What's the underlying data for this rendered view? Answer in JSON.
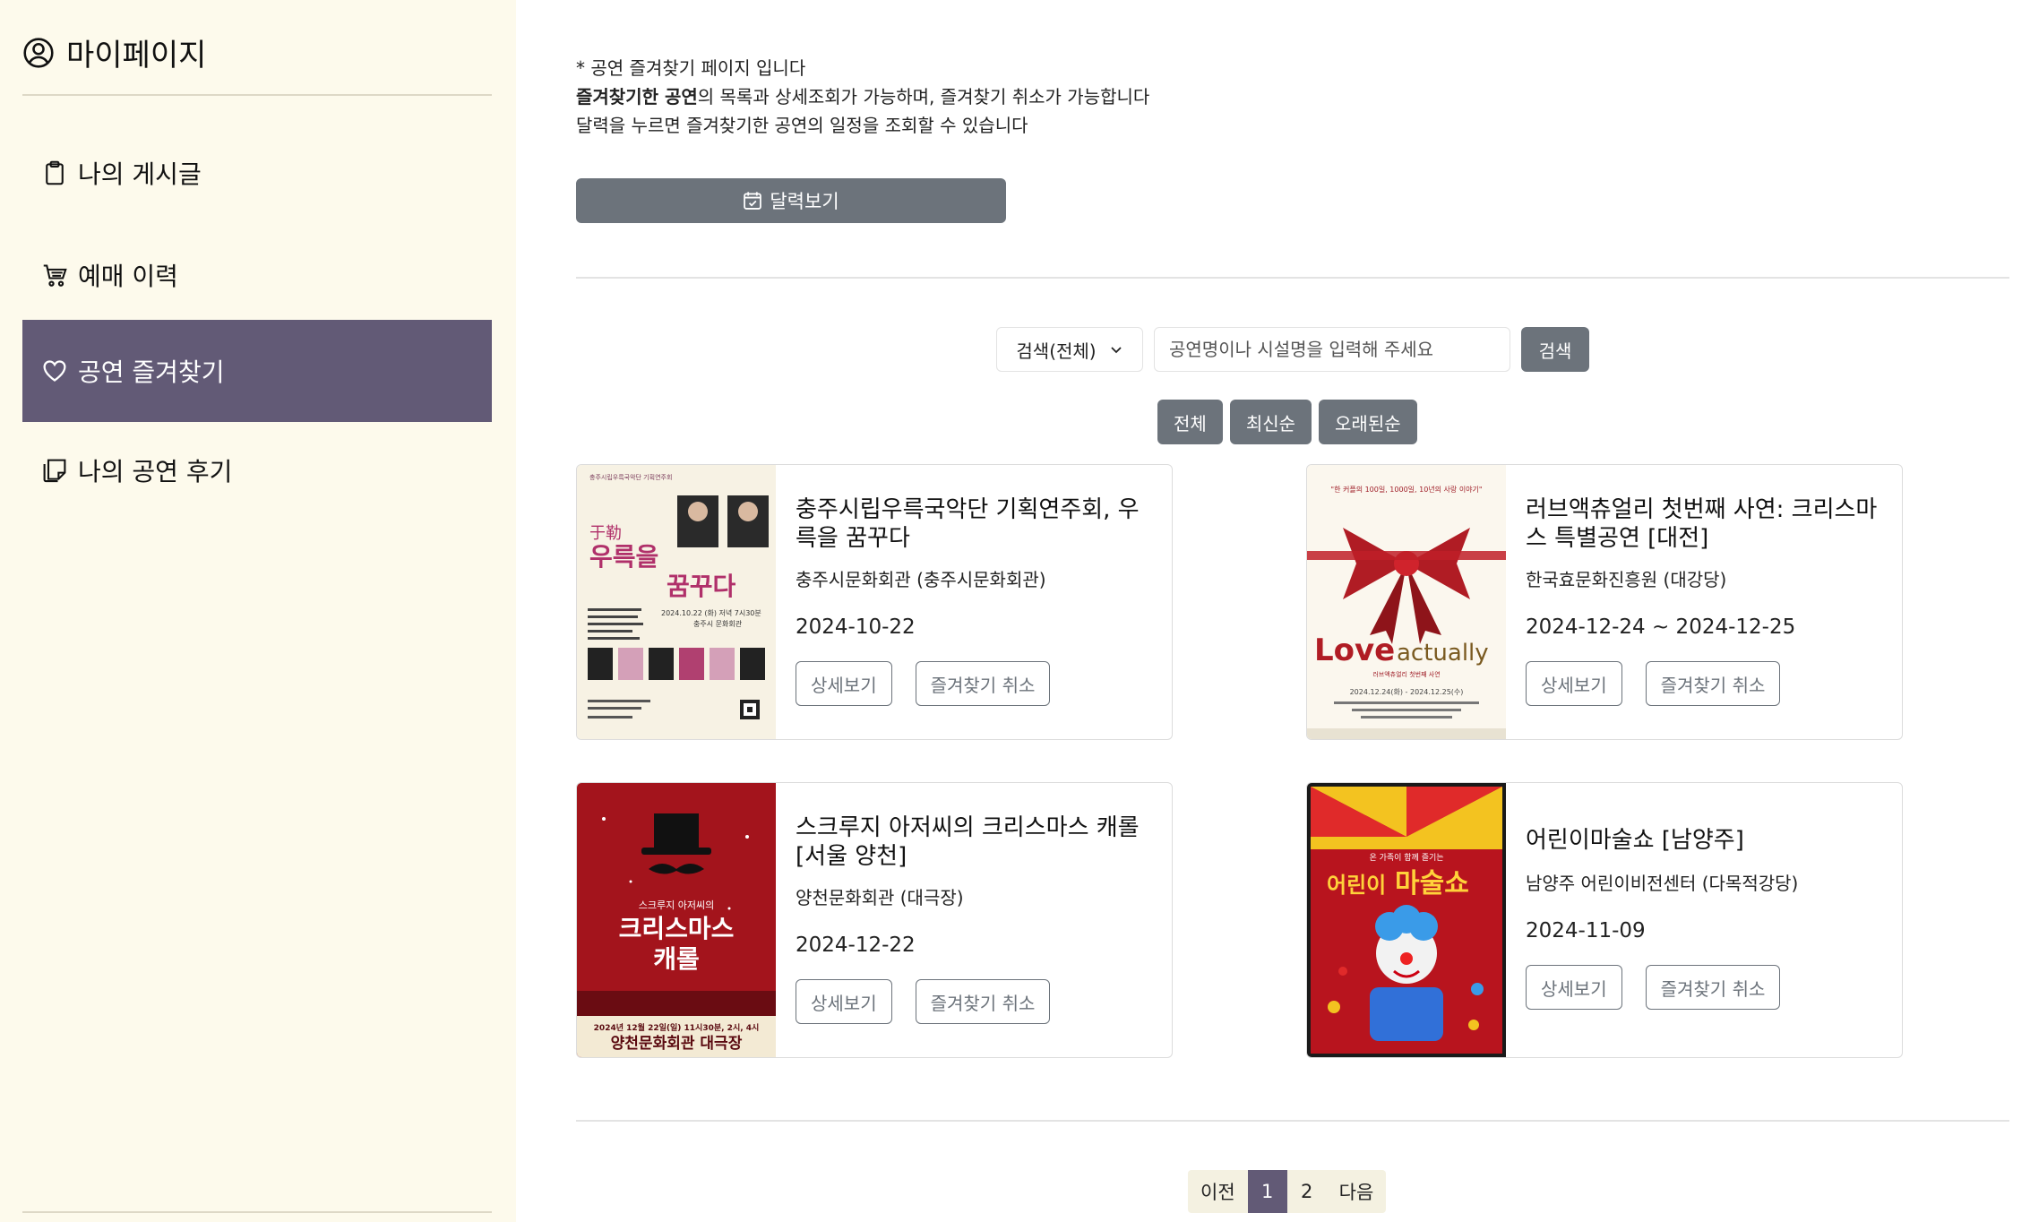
{
  "sidebar": {
    "title": "마이페이지",
    "items": [
      {
        "label": "나의 게시글",
        "icon": "clipboard-icon"
      },
      {
        "label": "예매 이력",
        "icon": "cart-icon"
      },
      {
        "label": "공연 즐겨찾기",
        "icon": "heart-icon",
        "active": true
      },
      {
        "label": "나의 공연 후기",
        "icon": "stickies-icon"
      }
    ]
  },
  "notice": {
    "line1": "* 공연 즐겨찾기 페이지 입니다",
    "line2_bold": "즐겨찾기한 공연",
    "line2_rest": "의 목록과 상세조회가 가능하며, 즐겨찾기 취소가 가능합니다",
    "line3": "달력을 누르면 즐겨찾기한 공연의 일정을 조회할 수 있습니다"
  },
  "calendar_button": "달력보기",
  "search": {
    "select_value": "검색(전체)",
    "placeholder": "공연명이나 시설명을 입력해 주세요",
    "button": "검색"
  },
  "sort": [
    "전체",
    "최신순",
    "오래된순"
  ],
  "card_actions": {
    "detail": "상세보기",
    "unfavorite": "즐겨찾기 취소"
  },
  "cards": [
    {
      "title": "충주시립우륵국악단 기획연주회, 우륵을 꿈꾸다",
      "venue": "충주시문화회관 (충주시문화회관)",
      "date": "2024-10-22",
      "poster": {
        "small": "충주시립우륵국악단 기획연주회",
        "hanja": "于勒",
        "t1": "우륵을",
        "t2": "꿈꾸다",
        "when": "2024.10.22 (화) 저녁 7시30분",
        "where": "충주시 문화회관"
      }
    },
    {
      "title": "러브액츄얼리 첫번째 사연: 크리스마스 특별공연 [대전]",
      "venue": "한국효문화진흥원 (대강당)",
      "date": "2024-12-24 ~ 2024-12-25",
      "poster": {
        "top": "\"한 커플의 100일, 1000일, 10년의 사랑 이야기\"",
        "t1": "Love",
        "t2": "actually",
        "sub": "러브액츄얼리 첫번째 사연",
        "when": "2024.12.24(화) - 2024.12.25(수)"
      }
    },
    {
      "title": "스크루지 아저씨의 크리스마스 캐롤 [서울 양천]",
      "venue": "양천문화회관 (대극장)",
      "date": "2024-12-22",
      "poster": {
        "t0": "스크루지 아저씨의",
        "t1": "크리스마스",
        "t2": "캐롤",
        "when": "2024년 12월 22일(일) 11시30분, 2시, 4시",
        "where": "양천문화회관 대극장"
      }
    },
    {
      "title": "어린이마술쇼 [남양주]",
      "venue": "남양주 어린이비전센터 (다목적강당)",
      "date": "2024-11-09",
      "poster": {
        "t0": "온 가족이 함께 즐기는",
        "t1": "어린이",
        "t2": "마술쇼"
      }
    }
  ],
  "pagination": {
    "prev": "이전",
    "pages": [
      "1",
      "2"
    ],
    "current": "1",
    "next": "다음"
  },
  "colors": {
    "sidebar_bg": "#fdfaec",
    "active_item": "#625a76",
    "button_gray": "#6c737b"
  }
}
